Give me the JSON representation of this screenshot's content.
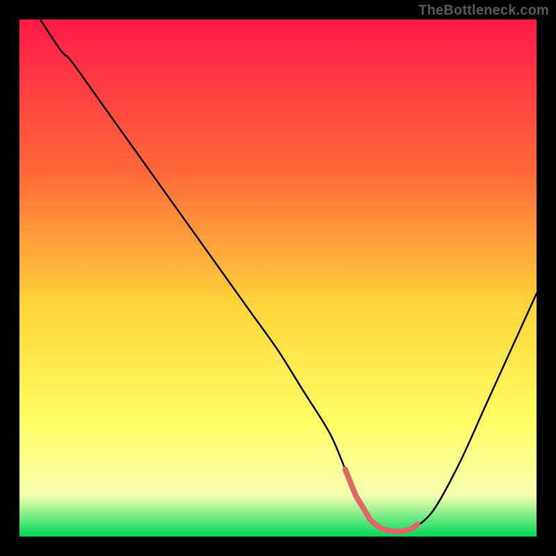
{
  "watermark": "TheBottleneck.com",
  "colors": {
    "background": "#000000",
    "curve": "#000000",
    "highlight": "#e16666",
    "grad_top": "#ff1a49",
    "grad_mid1": "#ff6a3a",
    "grad_mid2": "#ffd33a",
    "grad_mid3": "#ffff66",
    "grad_mid4": "#f6ffb0",
    "grad_bottom": "#00d85a"
  },
  "chart_data": {
    "type": "line",
    "title": "",
    "xlabel": "",
    "ylabel": "",
    "xlim": [
      0,
      100
    ],
    "ylim": [
      0,
      100
    ],
    "x": [
      4,
      8,
      10,
      15,
      20,
      25,
      30,
      35,
      40,
      45,
      50,
      55,
      60,
      63,
      65,
      68,
      70,
      72,
      74,
      76,
      80,
      85,
      90,
      95,
      100
    ],
    "y": [
      100,
      94,
      92,
      85,
      78,
      71,
      64,
      57,
      50,
      43,
      36,
      28,
      20,
      13,
      8,
      3,
      1.5,
      1,
      1,
      1.5,
      5,
      14,
      25,
      36,
      47
    ],
    "annotations": [
      {
        "kind": "highlight_segment",
        "x_start": 63,
        "x_end": 77
      }
    ]
  }
}
